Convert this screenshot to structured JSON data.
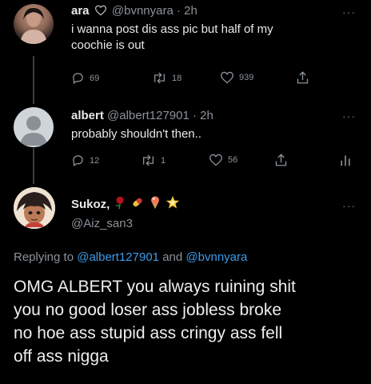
{
  "tweet1": {
    "name": "ara",
    "handle": "@bvnnyara",
    "time": "· 2h",
    "text_line1": "i wanna post dis ass pic but half of my",
    "text_line2": "coochie is out",
    "replies": "69",
    "retweets": "18",
    "likes": "939"
  },
  "tweet2": {
    "name": "albert",
    "handle": "@albert127901",
    "time": "· 2h",
    "text": "probably shouldn't then..",
    "replies": "12",
    "retweets": "1",
    "likes": "56"
  },
  "tweet3": {
    "name": "Sukoz,",
    "handle": "@Aiz_san3",
    "replying_prefix": "Replying to",
    "replying_user1": "@albert127901",
    "replying_and": "and",
    "replying_user2": "@bvnnyara",
    "text_line1": "OMG ALBERT you always ruining shit",
    "text_line2": "you no good loser ass jobless broke",
    "text_line3": "no hoe ass stupid ass cringy ass fell",
    "text_line4": "off ass nigga"
  },
  "more_label": "···",
  "colors": {
    "background": "#000000",
    "link": "#3d9be9",
    "muted": "#8b9299"
  }
}
